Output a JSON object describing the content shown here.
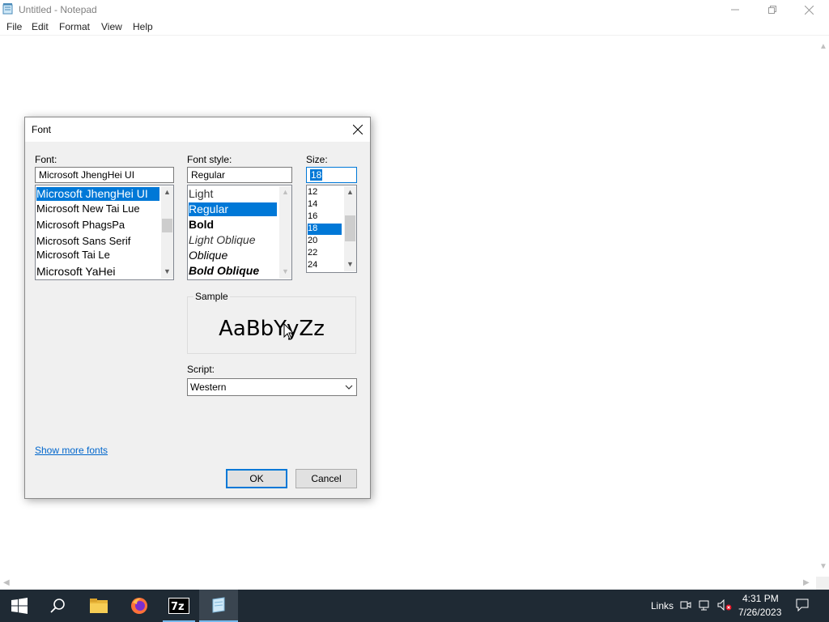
{
  "notepad": {
    "title": "Untitled - Notepad",
    "menu": [
      "File",
      "Edit",
      "Format",
      "View",
      "Help"
    ]
  },
  "dialog": {
    "title": "Font",
    "font_label": "Font:",
    "font_value": "Microsoft JhengHei UI",
    "font_list": [
      "Microsoft JhengHei UI",
      "Microsoft New Tai Lue",
      "Microsoft PhagsPa",
      "Microsoft Sans Serif",
      "Microsoft Tai Le",
      "Microsoft YaHei"
    ],
    "style_label": "Font style:",
    "style_value": "Regular",
    "style_list": [
      "Light",
      "Regular",
      "Bold",
      "Light Oblique",
      "Oblique",
      "Bold Oblique"
    ],
    "size_label": "Size:",
    "size_value": "18",
    "size_list": [
      "12",
      "14",
      "16",
      "18",
      "20",
      "22",
      "24"
    ],
    "sample_label": "Sample",
    "sample_text": "AaBbYyZz",
    "script_label": "Script:",
    "script_value": "Western",
    "show_more": "Show more fonts",
    "ok": "OK",
    "cancel": "Cancel"
  },
  "taskbar": {
    "links": "Links",
    "time": "4:31 PM",
    "date": "7/26/2023",
    "active_color": "#76b9ed"
  }
}
